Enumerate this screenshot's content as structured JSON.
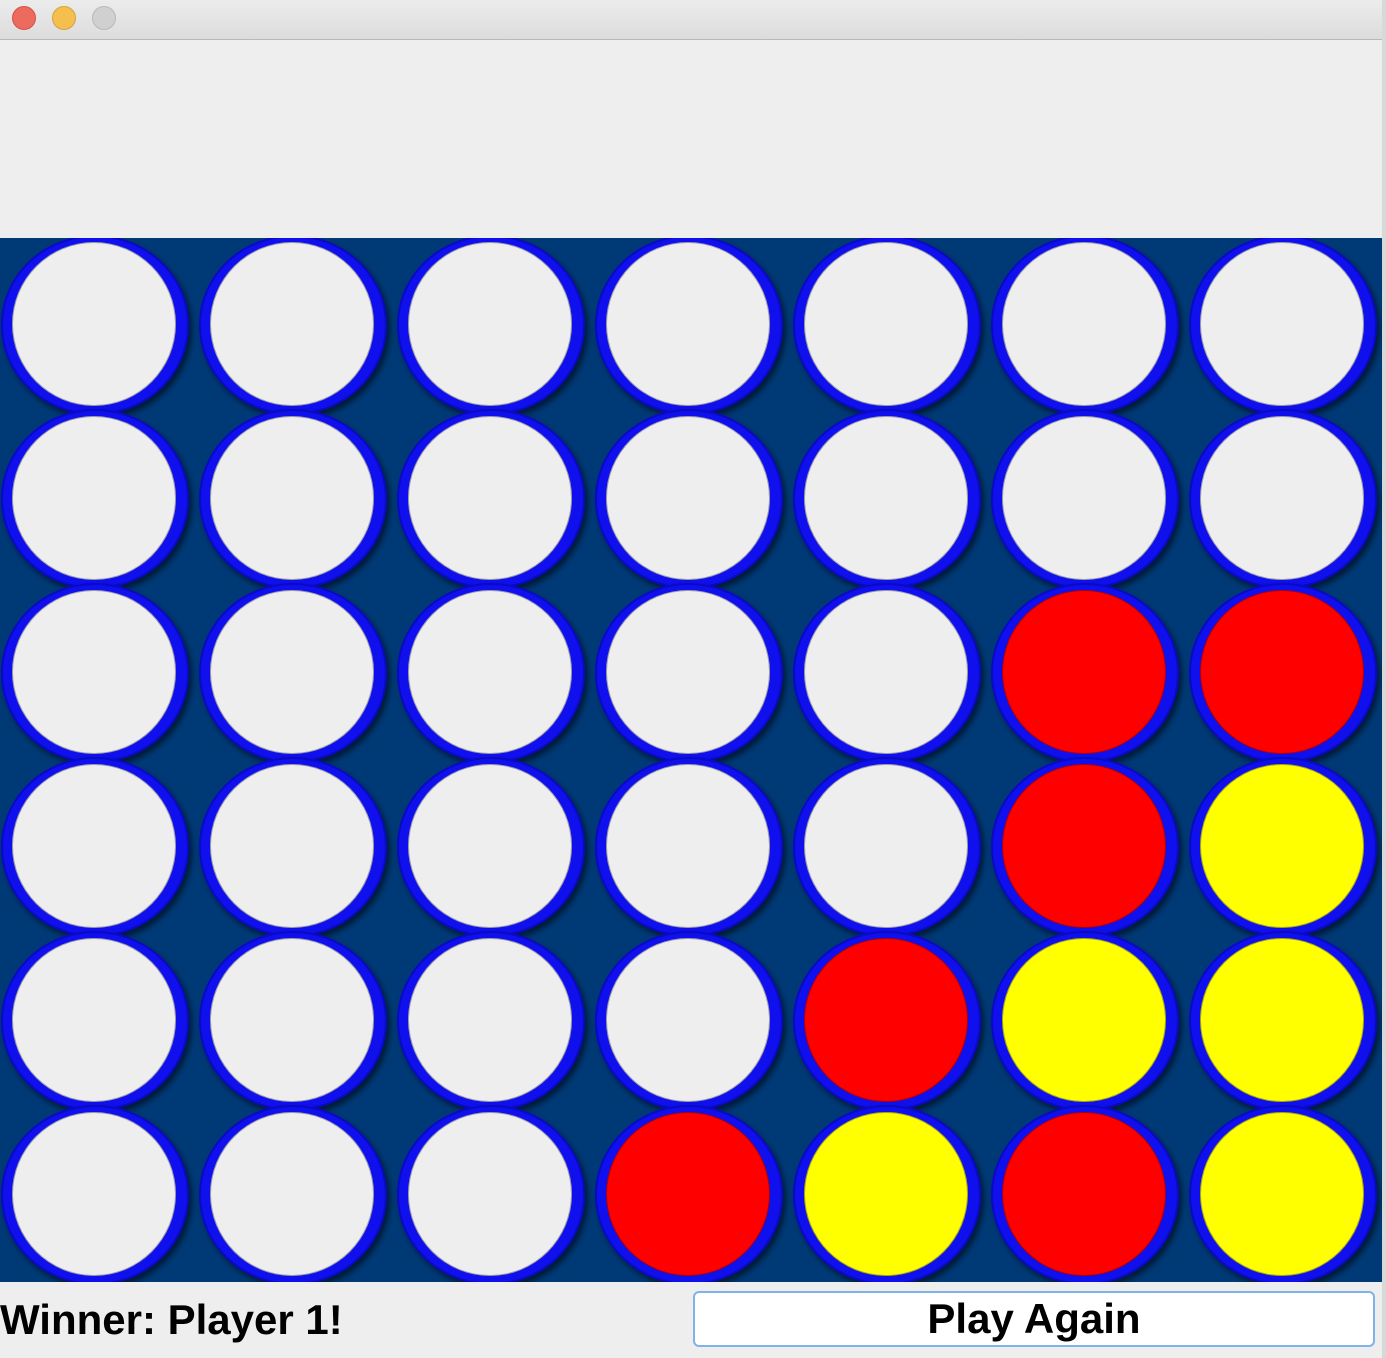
{
  "window": {
    "controls": [
      "close",
      "minimize",
      "zoom"
    ]
  },
  "game": {
    "name": "Connect Four",
    "rows": 6,
    "columns": 7,
    "colors": {
      "board": "#003a76",
      "ring": "#1010ee",
      "empty": "#eeeeee",
      "red": "#ff0000",
      "yellow": "#ffff00"
    },
    "grid": [
      [
        "empty",
        "empty",
        "empty",
        "empty",
        "empty",
        "empty",
        "empty"
      ],
      [
        "empty",
        "empty",
        "empty",
        "empty",
        "empty",
        "empty",
        "empty"
      ],
      [
        "empty",
        "empty",
        "empty",
        "empty",
        "empty",
        "red",
        "red"
      ],
      [
        "empty",
        "empty",
        "empty",
        "empty",
        "empty",
        "red",
        "yellow"
      ],
      [
        "empty",
        "empty",
        "empty",
        "empty",
        "red",
        "yellow",
        "yellow"
      ],
      [
        "empty",
        "empty",
        "empty",
        "red",
        "yellow",
        "red",
        "yellow"
      ]
    ]
  },
  "status": {
    "winner_text": "Winner: Player 1!",
    "play_again_label": "Play Again"
  }
}
